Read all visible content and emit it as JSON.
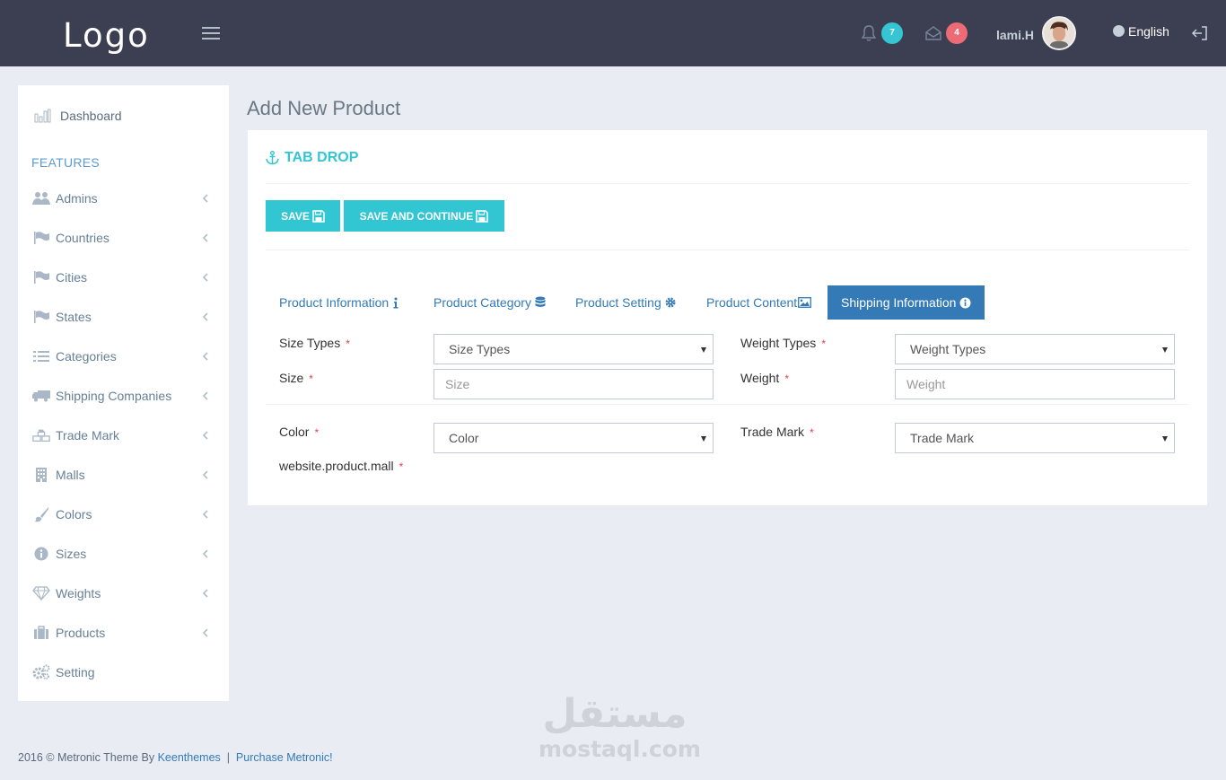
{
  "header": {
    "logo": "Logo",
    "notifications_count": "7",
    "messages_count": "4",
    "username": "lami.H",
    "language": "English"
  },
  "sidebar": {
    "dashboard": "Dashboard",
    "heading": "FEATURES",
    "items": [
      {
        "label": "Admins",
        "icon": "users-icon"
      },
      {
        "label": "Countries",
        "icon": "flag-icon"
      },
      {
        "label": "Cities",
        "icon": "flag-icon"
      },
      {
        "label": "States",
        "icon": "flag-icon"
      },
      {
        "label": "Categories",
        "icon": "list-icon"
      },
      {
        "label": "Shipping Companies",
        "icon": "truck-icon"
      },
      {
        "label": "Trade Mark",
        "icon": "cubes-icon"
      },
      {
        "label": "Malls",
        "icon": "building-icon"
      },
      {
        "label": "Colors",
        "icon": "paint-brush-icon"
      },
      {
        "label": "Sizes",
        "icon": "info-circle-icon"
      },
      {
        "label": "Weights",
        "icon": "diamond-icon"
      },
      {
        "label": "Products",
        "icon": "briefcase-icon"
      },
      {
        "label": "Setting",
        "icon": "gears-icon"
      }
    ]
  },
  "page": {
    "title": "Add New Product",
    "portlet_title": "TAB DROP",
    "save_label": "SAVE",
    "save_continue_label": "SAVE AND CONTINUE"
  },
  "tabs": [
    {
      "label": "Product Information",
      "icon": "info-icon"
    },
    {
      "label": "Product Category",
      "icon": "database-icon"
    },
    {
      "label": "Product Setting",
      "icon": "gear-icon"
    },
    {
      "label": "Product Content",
      "icon": "image-icon"
    },
    {
      "label": "Shipping Information",
      "icon": "info-circle-icon",
      "active": true
    }
  ],
  "form": {
    "size_types_label": "Size Types",
    "size_types_value": "Size Types",
    "weight_types_label": "Weight Types",
    "weight_types_value": "Weight Types",
    "size_label": "Size",
    "size_placeholder": "Size",
    "weight_label": "Weight",
    "weight_placeholder": "Weight",
    "color_label": "Color",
    "color_value": "Color",
    "trade_mark_label": "Trade Mark",
    "trade_mark_value": "Trade Mark",
    "mall_label": "website.product.mall",
    "required_mark": "*"
  },
  "footer": {
    "copyright": "2016 © Metronic Theme By ",
    "author_link": "Keenthemes",
    "separator": "  |  ",
    "purchase_link": "Purchase Metronic!"
  },
  "watermark": {
    "arabic": "مستقل",
    "latin": "mostaql.com"
  },
  "colors": {
    "header_bg": "#3b3f51",
    "accent_teal": "#32c5d2",
    "active_tab": "#337ab7",
    "badge_red": "#ed6b75"
  }
}
